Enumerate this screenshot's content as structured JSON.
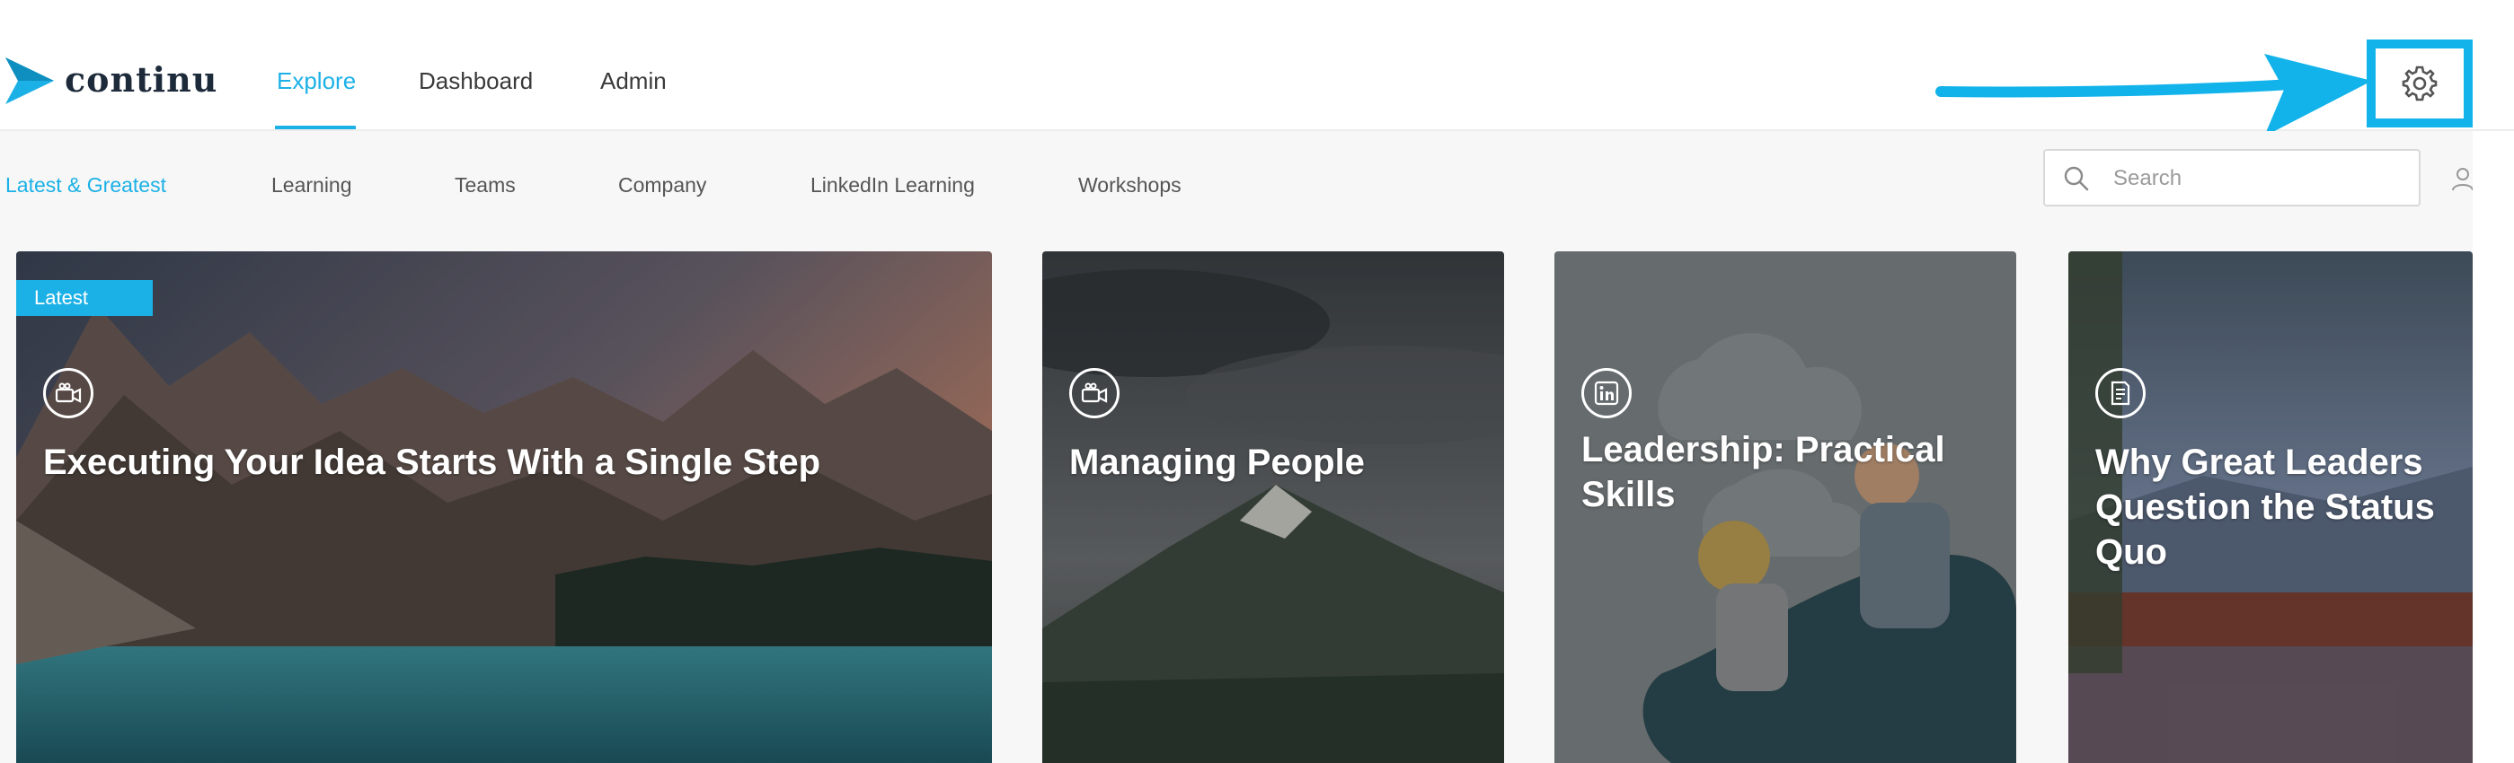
{
  "app": {
    "logo_text": "continu"
  },
  "nav": {
    "items": [
      {
        "label": "Explore",
        "active": true
      },
      {
        "label": "Dashboard",
        "active": false
      },
      {
        "label": "Admin",
        "active": false
      }
    ]
  },
  "header_icons": {
    "settings": "gear-icon"
  },
  "subnav": {
    "tabs": [
      {
        "label": "Latest & Greatest",
        "active": true
      },
      {
        "label": "Learning"
      },
      {
        "label": "Teams"
      },
      {
        "label": "Company"
      },
      {
        "label": "LinkedIn Learning"
      },
      {
        "label": "Workshops"
      }
    ]
  },
  "search": {
    "placeholder": "Search",
    "value": ""
  },
  "cards": [
    {
      "badge": "Latest",
      "icon": "video-icon",
      "title": "Executing Your Idea Starts With a Single Step"
    },
    {
      "icon": "video-icon",
      "title": "Managing People"
    },
    {
      "icon": "linkedin-icon",
      "title": "Leadership: Practical Skills"
    },
    {
      "icon": "article-icon",
      "title": "Why Great Leaders Question the Status Quo"
    }
  ],
  "colors": {
    "accent": "#1cb1e6",
    "callout": "#12b3ea",
    "text": "#333333"
  }
}
